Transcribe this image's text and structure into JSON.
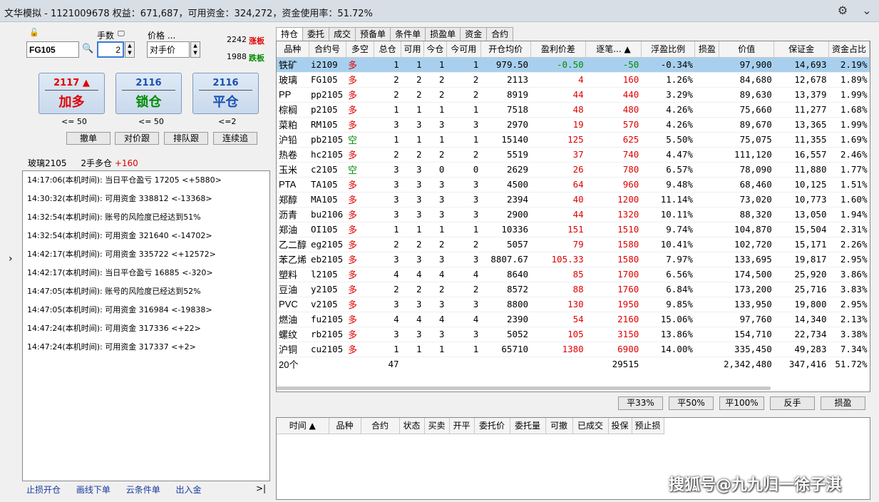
{
  "title": "文华模拟 - 1121009678  权益：671,687，可用资金：324,272，资金使用率：51.72%",
  "order": {
    "contract_value": "FG105",
    "qty_label": "手数",
    "qty_value": "2",
    "price_label": "价格 ...",
    "price_value": "对手价",
    "limit_up_price": "2242",
    "limit_up_label": "涨板",
    "limit_down_price": "1988",
    "limit_down_label": "跌板",
    "buttons": [
      {
        "price": "2117 ▲",
        "action": "加多",
        "sub": "<= 50"
      },
      {
        "price": "2116",
        "action": "锁仓",
        "sub": "<= 50"
      },
      {
        "price": "2116",
        "action": "平仓",
        "sub": "<=2"
      }
    ],
    "small_buttons": [
      "撤单",
      "对价跟",
      "排队跟",
      "连续追"
    ]
  },
  "position_info": {
    "name": "玻璃2105",
    "desc": "2手多仓",
    "pnl": "+160"
  },
  "logs": [
    "14:17:06(本机时间): 当日平仓盈亏 17205  <+5880>",
    "14:30:32(本机时间): 可用资金 338812  <-13368>",
    "14:32:54(本机时间): 账号的风险度已经达到51%",
    "14:32:54(本机时间): 可用资金 321640  <-14702>",
    "14:42:17(本机时间): 可用资金 335722  <+12572>",
    "14:42:17(本机时间): 当日平仓盈亏 16885  <-320>",
    "14:47:05(本机时间): 账号的风险度已经达到52%",
    "14:47:05(本机时间): 可用资金 316984  <-19838>",
    "14:47:24(本机时间): 可用资金 317336  <+22>",
    "14:47:24(本机时间): 可用资金 317337  <+2>"
  ],
  "links": [
    "止损开仓",
    "画线下单",
    "云条件单",
    "出入金"
  ],
  "tabs": [
    "持仓",
    "委托",
    "成交",
    "预备单",
    "条件单",
    "损盈单",
    "资金",
    "合约"
  ],
  "columns": [
    "品种",
    "合约号",
    "多空",
    "总仓",
    "可用",
    "今仓",
    "今可用",
    "开仓均价",
    "盈利价差",
    "逐笔... ▲",
    "浮盈比例",
    "损盈",
    "价值",
    "保证金",
    "资金占比"
  ],
  "rows": [
    [
      "铁矿",
      "i2109",
      "多",
      "1",
      "1",
      "1",
      "1",
      "979.50",
      "-0.50",
      "-50",
      "-0.34%",
      "",
      "97,900",
      "14,693",
      "2.19%"
    ],
    [
      "玻璃",
      "FG105",
      "多",
      "2",
      "2",
      "2",
      "2",
      "2113",
      "4",
      "160",
      "1.26%",
      "",
      "84,680",
      "12,678",
      "1.89%"
    ],
    [
      "PP",
      "pp2105",
      "多",
      "2",
      "2",
      "2",
      "2",
      "8919",
      "44",
      "440",
      "3.29%",
      "",
      "89,630",
      "13,379",
      "1.99%"
    ],
    [
      "棕榈",
      "p2105",
      "多",
      "1",
      "1",
      "1",
      "1",
      "7518",
      "48",
      "480",
      "4.26%",
      "",
      "75,660",
      "11,277",
      "1.68%"
    ],
    [
      "菜粕",
      "RM105",
      "多",
      "3",
      "3",
      "3",
      "3",
      "2970",
      "19",
      "570",
      "4.26%",
      "",
      "89,670",
      "13,365",
      "1.99%"
    ],
    [
      "沪铅",
      "pb2105",
      "空",
      "1",
      "1",
      "1",
      "1",
      "15140",
      "125",
      "625",
      "5.50%",
      "",
      "75,075",
      "11,355",
      "1.69%"
    ],
    [
      "热卷",
      "hc2105",
      "多",
      "2",
      "2",
      "2",
      "2",
      "5519",
      "37",
      "740",
      "4.47%",
      "",
      "111,120",
      "16,557",
      "2.46%"
    ],
    [
      "玉米",
      "c2105",
      "空",
      "3",
      "3",
      "0",
      "0",
      "2629",
      "26",
      "780",
      "6.57%",
      "",
      "78,090",
      "11,880",
      "1.77%"
    ],
    [
      "PTA",
      "TA105",
      "多",
      "3",
      "3",
      "3",
      "3",
      "4500",
      "64",
      "960",
      "9.48%",
      "",
      "68,460",
      "10,125",
      "1.51%"
    ],
    [
      "郑醇",
      "MA105",
      "多",
      "3",
      "3",
      "3",
      "3",
      "2394",
      "40",
      "1200",
      "11.14%",
      "",
      "73,020",
      "10,773",
      "1.60%"
    ],
    [
      "沥青",
      "bu2106",
      "多",
      "3",
      "3",
      "3",
      "3",
      "2900",
      "44",
      "1320",
      "10.11%",
      "",
      "88,320",
      "13,050",
      "1.94%"
    ],
    [
      "郑油",
      "OI105",
      "多",
      "1",
      "1",
      "1",
      "1",
      "10336",
      "151",
      "1510",
      "9.74%",
      "",
      "104,870",
      "15,504",
      "2.31%"
    ],
    [
      "乙二醇",
      "eg2105",
      "多",
      "2",
      "2",
      "2",
      "2",
      "5057",
      "79",
      "1580",
      "10.41%",
      "",
      "102,720",
      "15,171",
      "2.26%"
    ],
    [
      "苯乙烯",
      "eb2105",
      "多",
      "3",
      "3",
      "3",
      "3",
      "8807.67",
      "105.33",
      "1580",
      "7.97%",
      "",
      "133,695",
      "19,817",
      "2.95%"
    ],
    [
      "塑料",
      "l2105",
      "多",
      "4",
      "4",
      "4",
      "4",
      "8640",
      "85",
      "1700",
      "6.56%",
      "",
      "174,500",
      "25,920",
      "3.86%"
    ],
    [
      "豆油",
      "y2105",
      "多",
      "2",
      "2",
      "2",
      "2",
      "8572",
      "88",
      "1760",
      "6.84%",
      "",
      "173,200",
      "25,716",
      "3.83%"
    ],
    [
      "PVC",
      "v2105",
      "多",
      "3",
      "3",
      "3",
      "3",
      "8800",
      "130",
      "1950",
      "9.85%",
      "",
      "133,950",
      "19,800",
      "2.95%"
    ],
    [
      "燃油",
      "fu2105",
      "多",
      "4",
      "4",
      "4",
      "4",
      "2390",
      "54",
      "2160",
      "15.06%",
      "",
      "97,760",
      "14,340",
      "2.13%"
    ],
    [
      "螺纹",
      "rb2105",
      "多",
      "3",
      "3",
      "3",
      "3",
      "5052",
      "105",
      "3150",
      "13.86%",
      "",
      "154,710",
      "22,734",
      "3.38%"
    ],
    [
      "沪铜",
      "cu2105",
      "多",
      "1",
      "1",
      "1",
      "1",
      "65710",
      "1380",
      "6900",
      "14.00%",
      "",
      "335,450",
      "49,283",
      "7.34%"
    ]
  ],
  "summary": {
    "count": "20个",
    "total": "47",
    "pnl": "29515",
    "value": "2,342,480",
    "margin": "347,416",
    "ratio": "51.72%"
  },
  "action_buttons": [
    "平33%",
    "平50%",
    "平100%",
    "反手",
    "损盈"
  ],
  "order_columns": [
    "时间 ▲",
    "品种",
    "合约",
    "状态",
    "买卖",
    "开平",
    "委托价",
    "委托量",
    "可撤",
    "已成交",
    "投保",
    "预止损"
  ],
  "watermark": "搜狐号@九九归一徐子淇"
}
